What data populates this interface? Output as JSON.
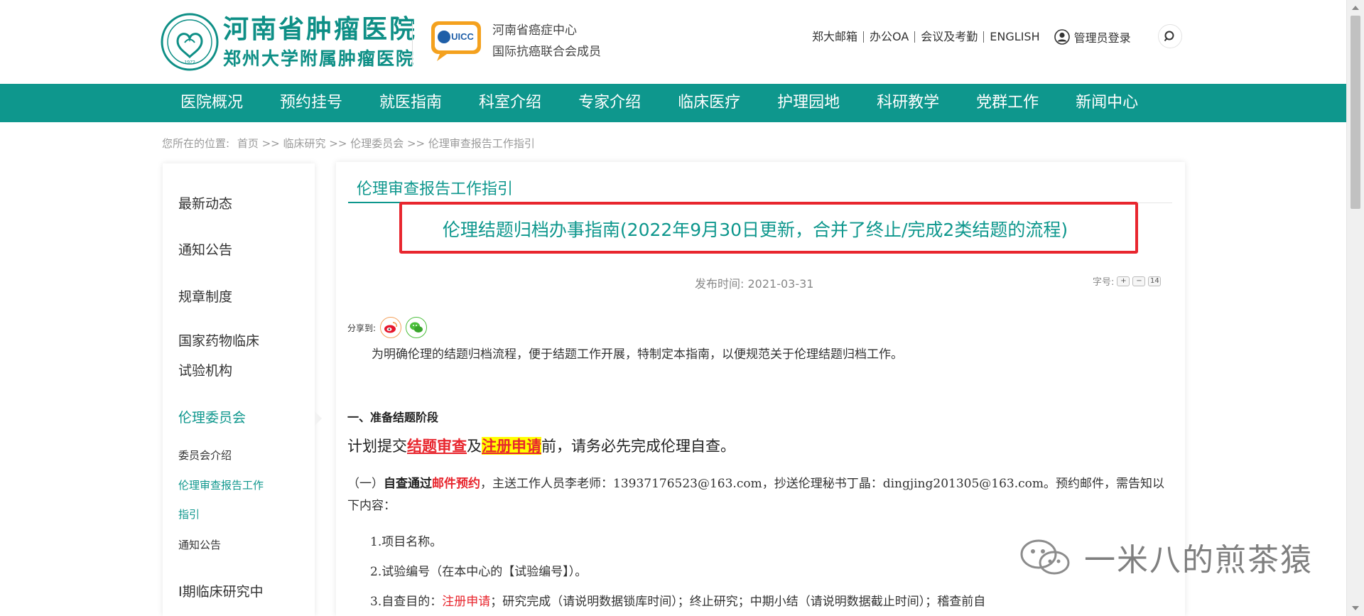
{
  "header": {
    "logo_line1": "河南省肿瘤医院",
    "logo_line2": "郑州大学附属肿瘤医院",
    "uicc_badge": "UICC",
    "partner_line1": "河南省癌症中心",
    "partner_line2": "国际抗癌联合会成员",
    "top_links": [
      "郑大邮箱",
      "办公OA",
      "会议及考勤",
      "ENGLISH"
    ],
    "admin_login": "管理员登录"
  },
  "nav": {
    "items": [
      "医院概况",
      "预约挂号",
      "就医指南",
      "科室介绍",
      "专家介绍",
      "临床医疗",
      "护理园地",
      "科研教学",
      "党群工作",
      "新闻中心"
    ]
  },
  "breadcrumb": {
    "label": "您所在的位置:",
    "path": "首页 >> 临床研究 >> 伦理委员会 >> 伦理审查报告工作指引"
  },
  "sidebar": {
    "items": [
      "最新动态",
      "通知公告",
      "规章制度",
      "国家药物临床",
      "试验机构",
      "伦理委员会"
    ],
    "sub_items": [
      "委员会介绍",
      "伦理审查报告工作",
      "指引",
      "通知公告"
    ],
    "last_item": "I期临床研究中"
  },
  "main": {
    "section_title": "伦理审查报告工作指引",
    "article_title": "伦理结题归档办事指南(2022年9月30日更新，合并了终止/完成2类结题的流程)",
    "pub_date": "发布时间: 2021-03-31",
    "font_size_label": "字号:",
    "font_size_value": "14",
    "share_label": "分享到:",
    "intro": "为明确伦理的结题归档流程，便于结题工作开展，特制定本指南，以便规范关于伦理结题归档工作。",
    "heading1": "一、准备结题阶段",
    "plan": {
      "pre": "计划提交",
      "red1": "结题审查",
      "mid": "及",
      "red2": "注册申请",
      "post": "前，请务必先完成伦理自查。"
    },
    "self_check": {
      "pre": "（一）",
      "bold": "自查通过",
      "red": "邮件预约",
      "post": "，主送工作人员李老师：13937176523@163.com，抄送伦理秘书丁晶：dingjing201305@163.com。预约邮件，需告知以下内容："
    },
    "list": {
      "item1": "1.项目名称。",
      "item2": "2.试验编号（在本中心的【试验编号】）。",
      "item3_pre": "3.自查目的：",
      "item3_red": "注册申请",
      "item3_post": "；研究完成（请说明数据锁库时间）；终止研究；中期小结（请说明数据截止时间）；稽查前自"
    }
  },
  "watermark": {
    "text": "一米八的煎茶猿"
  },
  "colors": {
    "brand": "#0e978d",
    "highlight_border": "#e8262e",
    "emphasis_red": "#e8262e",
    "marker_yellow": "#ffff00"
  }
}
